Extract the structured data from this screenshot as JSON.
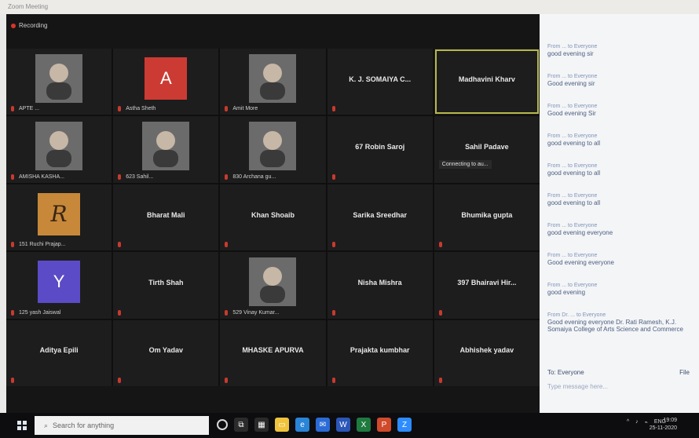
{
  "window": {
    "title": "Zoom Meeting",
    "recording_label": "Recording"
  },
  "tiles": [
    {
      "name": "APTE ...",
      "kind": "video",
      "mic": true,
      "active": false
    },
    {
      "name": "Astha Sheth",
      "kind": "avatar",
      "initial": "A",
      "color": "#cc3b33",
      "mic": true,
      "active": false
    },
    {
      "name": "Amit More",
      "kind": "video",
      "mic": true,
      "active": false
    },
    {
      "name": "K. J. SOMAIYA C...",
      "kind": "name",
      "mic": true,
      "active": false
    },
    {
      "name": "Madhavini Kharv",
      "kind": "name",
      "mic": false,
      "active": true
    },
    {
      "name": "AMISHA KASHA...",
      "kind": "video",
      "mic": true,
      "active": false
    },
    {
      "name": "623 Sahil...",
      "kind": "video",
      "mic": true,
      "active": false
    },
    {
      "name": "830 Archana gu...",
      "kind": "video",
      "mic": true,
      "active": false
    },
    {
      "name": "67 Robin Saroj",
      "kind": "name",
      "mic": true,
      "active": false
    },
    {
      "name": "Sahil Padave",
      "kind": "name",
      "mic": false,
      "active": false,
      "connecting": "Connecting to au..."
    },
    {
      "name": "151 Ruchi Prajap...",
      "kind": "avatar",
      "initial": "R",
      "color": "#c7883a",
      "mic": true,
      "active": false
    },
    {
      "name": "Bharat Mali",
      "kind": "name",
      "mic": true,
      "active": false
    },
    {
      "name": "Khan Shoaib",
      "kind": "name",
      "mic": true,
      "active": false
    },
    {
      "name": "Sarika Sreedhar",
      "kind": "name",
      "mic": true,
      "active": false
    },
    {
      "name": "Bhumika gupta",
      "kind": "name",
      "mic": true,
      "active": false
    },
    {
      "name": "125 yash Jaiswal",
      "kind": "avatar",
      "initial": "Y",
      "color": "#5b4bc6",
      "mic": true,
      "active": false
    },
    {
      "name": "Tirth Shah",
      "kind": "name",
      "mic": true,
      "active": false
    },
    {
      "name": "529 Vinay Kumar...",
      "kind": "video",
      "mic": true,
      "active": false
    },
    {
      "name": "Nisha Mishra",
      "kind": "name",
      "mic": true,
      "active": false
    },
    {
      "name": "397 Bhairavi Hir...",
      "kind": "name",
      "mic": true,
      "active": false
    },
    {
      "name": "Aditya Epili",
      "kind": "name",
      "mic": true,
      "active": false
    },
    {
      "name": "Om Yadav",
      "kind": "name",
      "mic": true,
      "active": false
    },
    {
      "name": "MHASKE APURVA",
      "kind": "name",
      "mic": true,
      "active": false
    },
    {
      "name": "Prajakta kumbhar",
      "kind": "name",
      "mic": true,
      "active": false
    },
    {
      "name": "Abhishek yadav",
      "kind": "name",
      "mic": true,
      "active": false
    }
  ],
  "chat": {
    "messages": [
      {
        "from": "From ... to Everyone",
        "text": "good evening sir"
      },
      {
        "from": "From ... to Everyone",
        "text": "Good evening sir"
      },
      {
        "from": "From ... to Everyone",
        "text": "Good evening Sir"
      },
      {
        "from": "From ... to Everyone",
        "text": "good evening to all"
      },
      {
        "from": "From ... to Everyone",
        "text": "good evening to all"
      },
      {
        "from": "From ... to Everyone",
        "text": "good evening to all"
      },
      {
        "from": "From ... to Everyone",
        "text": "good evening everyone"
      },
      {
        "from": "From ... to Everyone",
        "text": "Good evening everyone"
      },
      {
        "from": "From ... to Everyone",
        "text": "good evening"
      },
      {
        "from": "From Dr. ... to Everyone",
        "text": "Good evening everyone Dr. Rati Ramesh, K.J. Somaiya College of Arts Science and Commerce"
      }
    ],
    "to_label": "To: Everyone",
    "file_label": "File",
    "input_placeholder": "Type message here..."
  },
  "taskbar": {
    "search_placeholder": "Search for anything",
    "lang": "ENG",
    "time": "19:09",
    "date": "25-11-2020"
  }
}
